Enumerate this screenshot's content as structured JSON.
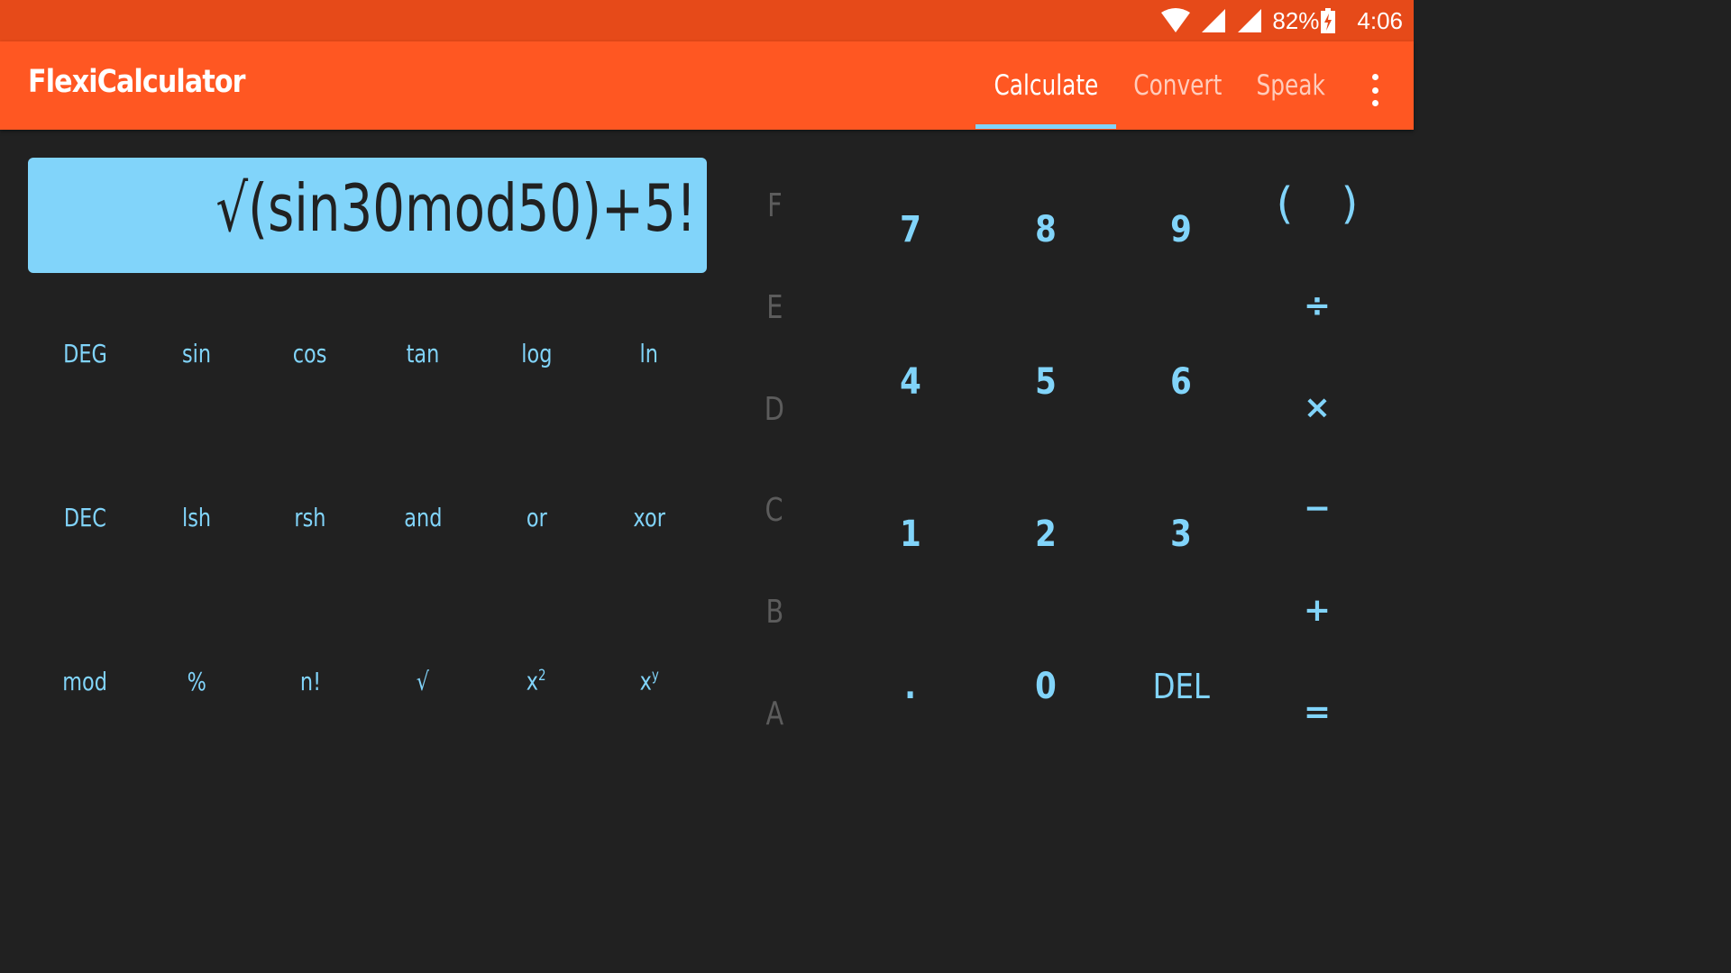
{
  "status": {
    "battery": "82%",
    "time": "4:06"
  },
  "appbar": {
    "title": "FlexiCalculator",
    "tabs": [
      {
        "label": "Calculate",
        "active": true
      },
      {
        "label": "Convert",
        "active": false
      },
      {
        "label": "Speak",
        "active": false
      }
    ]
  },
  "display": {
    "expression": "√(sin30mod50)+5!"
  },
  "function_keys": {
    "row1": [
      "DEG",
      "sin",
      "cos",
      "tan",
      "log",
      "ln"
    ],
    "row2": [
      "DEC",
      "lsh",
      "rsh",
      "and",
      "or",
      "xor"
    ],
    "row3": [
      "mod",
      "%",
      "n!",
      "√",
      "x",
      "x"
    ],
    "sup": [
      "2",
      "y"
    ]
  },
  "hex_keys": [
    "F",
    "E",
    "D",
    "C",
    "B",
    "A"
  ],
  "number_keys": [
    "7",
    "8",
    "9",
    "4",
    "5",
    "6",
    "1",
    "2",
    "3",
    ".",
    "0",
    "DEL"
  ],
  "operator_keys": {
    "open_paren": "(",
    "close_paren": ")",
    "divide": "÷",
    "multiply": "×",
    "subtract": "−",
    "add": "+",
    "equals": "="
  },
  "colors": {
    "status_bar": "#E64A19",
    "app_bar": "#FF5722",
    "accent": "#81D4FA",
    "background": "#212121",
    "hex_disabled": "#5c5c5c"
  }
}
